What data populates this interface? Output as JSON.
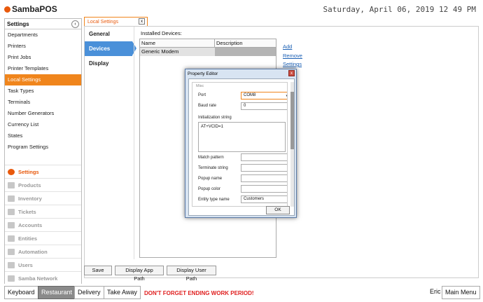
{
  "header": {
    "logo": "SambaPOS",
    "datetime": "Saturday, April 06, 2019 12 49 PM"
  },
  "left_panel": {
    "title": "Settings",
    "items": [
      {
        "label": "Departments"
      },
      {
        "label": "Printers"
      },
      {
        "label": "Print Jobs"
      },
      {
        "label": "Printer Templates"
      },
      {
        "label": "Local Settings",
        "active": true
      },
      {
        "label": "Task Types"
      },
      {
        "label": "Terminals"
      },
      {
        "label": "Number Generators"
      },
      {
        "label": "Currency List"
      },
      {
        "label": "States"
      },
      {
        "label": "Program Settings"
      }
    ],
    "modules": [
      {
        "label": "Settings",
        "icon": "gear-icon",
        "active": true
      },
      {
        "label": "Products",
        "icon": "cup-icon"
      },
      {
        "label": "Inventory",
        "icon": "boxes-icon"
      },
      {
        "label": "Tickets",
        "icon": "ticket-icon"
      },
      {
        "label": "Accounts",
        "icon": "calculator-icon"
      },
      {
        "label": "Entities",
        "icon": "list-icon"
      },
      {
        "label": "Automation",
        "icon": "pencil-icon"
      },
      {
        "label": "Users",
        "icon": "user-icon"
      },
      {
        "label": "Samba Network",
        "icon": "network-icon"
      }
    ]
  },
  "document_tab": {
    "label": "Local Settings",
    "close": "x"
  },
  "sub_nav": {
    "items": [
      {
        "label": "General"
      },
      {
        "label": "Devices",
        "active": true
      },
      {
        "label": "Display"
      }
    ]
  },
  "devices": {
    "installed_label": "Installed Devices:",
    "columns": [
      "Name",
      "Description"
    ],
    "rows": [
      {
        "name": "Generic Modem",
        "description": ""
      }
    ],
    "links": {
      "add": "Add",
      "remove": "Remove",
      "settings": "Settings"
    }
  },
  "bottom_buttons": {
    "save": "Save",
    "display_app_path": "Display App Path",
    "display_user_path": "Display User Path"
  },
  "property_editor": {
    "title": "Property Editor",
    "close": "x",
    "category": "Misc",
    "port": {
      "label": "Port",
      "value": "COM8"
    },
    "baud_rate": {
      "label": "Baud rate",
      "value": "0"
    },
    "init_string": {
      "label": "Initialization string",
      "value": "AT+VCID=1"
    },
    "match_pattern": {
      "label": "Match pattern",
      "value": ""
    },
    "terminate_string": {
      "label": "Terminate string",
      "value": ""
    },
    "popup_name": {
      "label": "Popup name",
      "value": ""
    },
    "popup_color": {
      "label": "Popup color",
      "value": ""
    },
    "entity_type_name": {
      "label": "Entity type name",
      "value": "Customers"
    },
    "ok": "OK"
  },
  "footer": {
    "keyboard": "Keyboard",
    "restaurant": "Restaurant",
    "delivery": "Delivery",
    "take_away": "Take Away",
    "warning": "DON'T FORGET ENDING WORK PERIOD!",
    "user": "Eric",
    "main_menu": "Main Menu"
  }
}
